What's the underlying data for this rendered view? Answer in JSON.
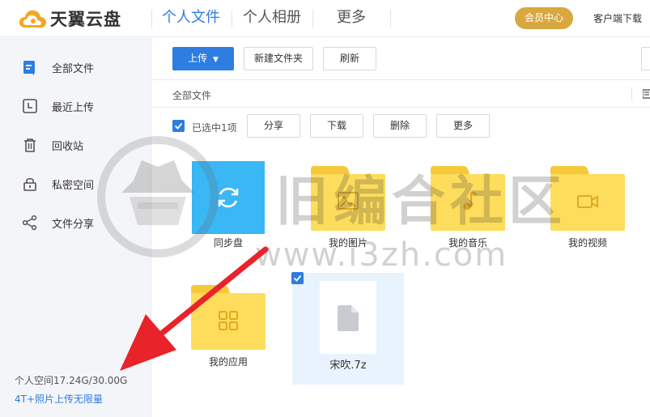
{
  "header": {
    "brand": "天翼云盘",
    "nav": [
      {
        "label": "个人文件",
        "active": true
      },
      {
        "label": "个人相册",
        "active": false
      },
      {
        "label": "更多",
        "active": false
      }
    ],
    "vip_button": "会员中心",
    "client_download": "客户端下载"
  },
  "sidebar": {
    "items": [
      {
        "label": "全部文件",
        "icon": "all-files-icon",
        "active": true
      },
      {
        "label": "最近上传",
        "icon": "recent-icon"
      },
      {
        "label": "回收站",
        "icon": "trash-icon"
      },
      {
        "label": "私密空间",
        "icon": "lock-icon"
      },
      {
        "label": "文件分享",
        "icon": "share-icon"
      }
    ],
    "quota": "个人空间17.24G/30.00G",
    "quota_link": "4T+照片上传无限量"
  },
  "toolbar": {
    "upload": "上传",
    "new_folder": "新建文件夹",
    "refresh": "刷新"
  },
  "breadcrumb": "全部文件",
  "selection": {
    "count_label": "已选中1项",
    "actions": [
      "分享",
      "下载",
      "删除",
      "更多"
    ]
  },
  "files": [
    {
      "name": "同步盘",
      "type": "sync-folder"
    },
    {
      "name": "我的图片",
      "type": "folder",
      "icon": "image-icon"
    },
    {
      "name": "我的音乐",
      "type": "folder",
      "icon": "music-icon"
    },
    {
      "name": "我的视频",
      "type": "folder",
      "icon": "video-icon"
    },
    {
      "name": "我的应用",
      "type": "folder",
      "icon": "apps-icon"
    },
    {
      "name": "宋吹.7z",
      "type": "file",
      "selected": true
    }
  ],
  "watermark": {
    "text": "旧编合社区",
    "url": "www.i3zh.com"
  },
  "colors": {
    "accent": "#2e7de1",
    "vip": "#d9a73f",
    "folder": "#fedd5c",
    "folder_tab": "#f6c93a",
    "sync": "#3ab7f5",
    "arrow": "#e8232a"
  }
}
